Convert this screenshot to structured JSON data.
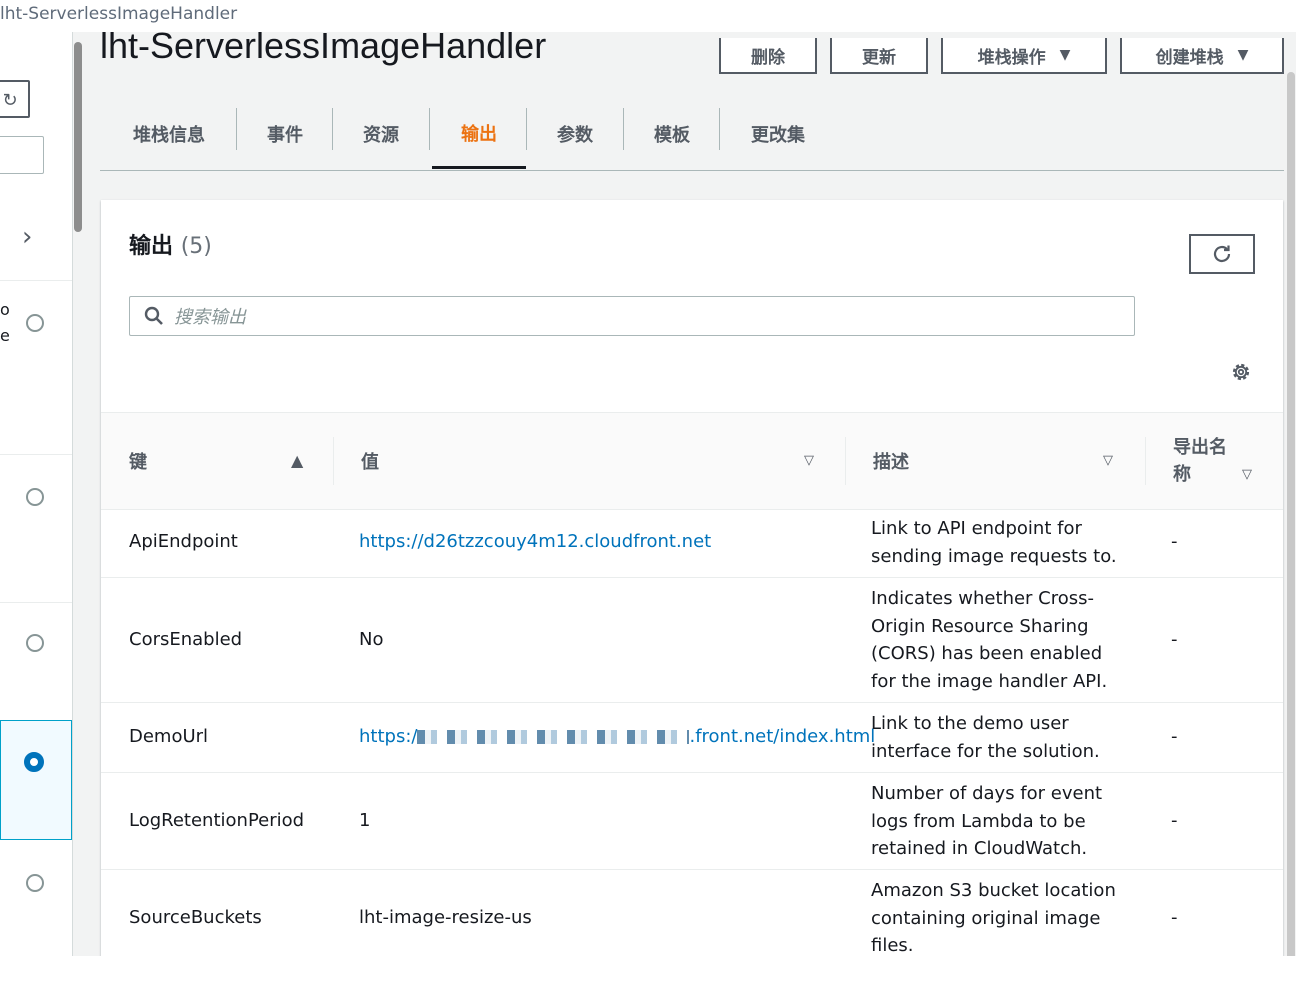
{
  "window": {
    "title": "lht-ServerlessImageHandler"
  },
  "left_panel": {
    "frag_1": "o",
    "frag_2": "e",
    "refresh_glyph": "↻"
  },
  "header": {
    "stack_name": "lht-ServerlessImageHandler",
    "buttons": {
      "delete": "删除",
      "update": "更新",
      "stack_actions": "堆栈操作",
      "create_stack": "创建堆栈"
    }
  },
  "tabs": [
    {
      "label": "堆栈信息"
    },
    {
      "label": "事件"
    },
    {
      "label": "资源"
    },
    {
      "label": "输出",
      "active": true
    },
    {
      "label": "参数"
    },
    {
      "label": "模板"
    },
    {
      "label": "更改集"
    }
  ],
  "outputs": {
    "title": "输出",
    "count": "(5)",
    "search_placeholder": "搜索输出",
    "columns": {
      "key": "键",
      "value": "值",
      "description": "描述",
      "export_name_1": "导出名",
      "export_name_2": "称"
    },
    "rows": [
      {
        "key": "ApiEndpoint",
        "value": "https://d26tzzcouy4m12.cloudfront.net",
        "is_link": true,
        "desc": [
          "Link to API endpoint for",
          "sending image requests to."
        ],
        "export": "-"
      },
      {
        "key": "CorsEnabled",
        "value": "No",
        "is_link": false,
        "desc": [
          "Indicates whether Cross-",
          "Origin Resource Sharing",
          "(CORS) has been enabled",
          "for the image handler API."
        ],
        "export": "-"
      },
      {
        "key": "DemoUrl",
        "value_prefix": "https:/",
        "value_suffix": ".front.net/index.html",
        "is_link": true,
        "desc": [
          "Link to the demo user",
          "interface for the solution."
        ],
        "export": "-"
      },
      {
        "key": "LogRetentionPeriod",
        "value": "1",
        "is_link": false,
        "desc": [
          "Number of days for event",
          "logs from Lambda to be",
          "retained in CloudWatch."
        ],
        "export": "-"
      },
      {
        "key": "SourceBuckets",
        "value": "lht-image-resize-us",
        "is_link": false,
        "desc": [
          "Amazon S3 bucket location",
          "containing original image",
          "files."
        ],
        "export": "-"
      }
    ]
  },
  "colors": {
    "accent": "#ec7211",
    "link": "#0073bb",
    "selected": "#0073bb"
  },
  "icons": [
    "refresh-icon",
    "search-icon",
    "settings-gear-icon",
    "sort-ascending-icon",
    "sort-descending-icon",
    "chevron-right-icon",
    "caret-down-icon"
  ]
}
